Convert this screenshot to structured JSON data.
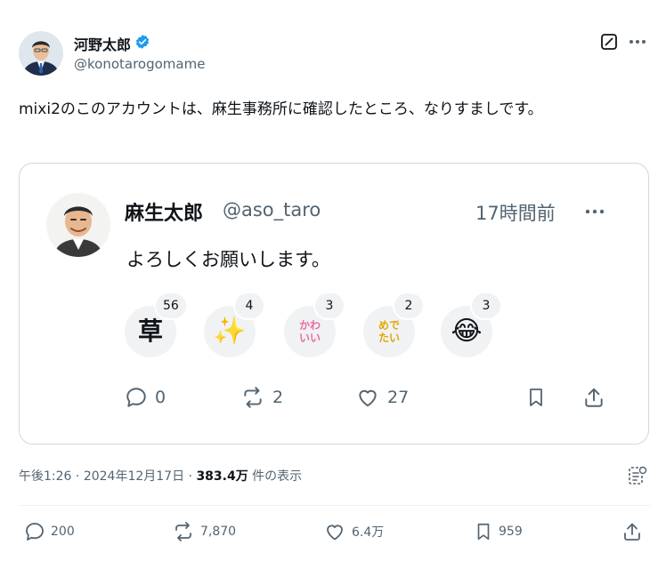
{
  "author": {
    "name": "河野太郎",
    "handle": "@konotarogomame",
    "verified": true
  },
  "post": {
    "text": "mixi2のこのアカウントは、麻生事務所に確認したところ、なりすましです。"
  },
  "embedded": {
    "name": "麻生太郎",
    "handle": "@aso_taro",
    "time": "17時間前",
    "text": "よろしくお願いします。",
    "reactions": [
      {
        "icon": "kusa-icon",
        "glyph": "草",
        "count": "56"
      },
      {
        "icon": "sparkles-icon",
        "glyph": "✨",
        "count": "4"
      },
      {
        "icon": "kawaii-icon",
        "glyph": "かわいい",
        "count": "3"
      },
      {
        "icon": "medetai-icon",
        "glyph": "めでたい",
        "count": "2"
      },
      {
        "icon": "tears-of-joy-icon",
        "glyph": "😂",
        "count": "3"
      }
    ],
    "actions": {
      "replies": "0",
      "reposts": "2",
      "likes": "27"
    }
  },
  "meta": {
    "time": "午後1:26",
    "sep1": " · ",
    "date": "2024年12月17日",
    "sep2": " · ",
    "views": "383.4万",
    "views_suffix": " 件の表示"
  },
  "actions": {
    "replies": "200",
    "reposts": "7,870",
    "likes": "6.4万",
    "bookmarks": "959"
  },
  "colors": {
    "text": "#0f1419",
    "muted": "#536471",
    "border": "#cfd9de",
    "verified": "#1d9bf0",
    "reaction_bg": "#f0f2f4"
  }
}
